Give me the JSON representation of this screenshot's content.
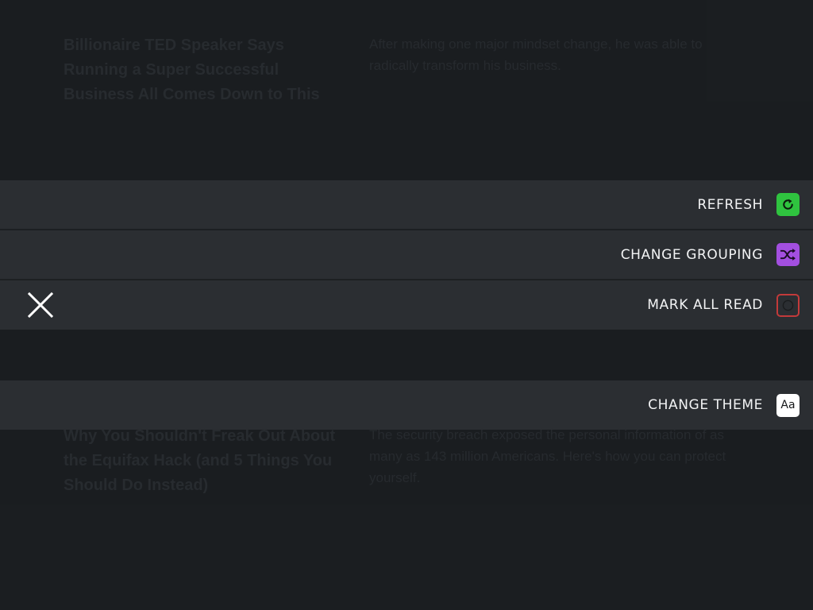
{
  "background_articles": [
    {
      "title": "Billionaire TED Speaker Says Running a Super Successful Business All Comes Down to This",
      "summary": "After making one major mindset change, he was able to radically transform his business."
    },
    {
      "title": "Why You Shouldn't Freak Out About the Equifax Hack (and 5 Things You Should Do Instead)",
      "summary": "The security breach exposed the personal information of as many as 143 million Americans. Here's how you can protect yourself."
    }
  ],
  "menu": {
    "items": [
      {
        "label": "REFRESH",
        "icon": "refresh-icon",
        "color": "#2fc33f"
      },
      {
        "label": "CHANGE GROUPING",
        "icon": "shuffle-icon",
        "color": "#a34fe0"
      },
      {
        "label": "MARK ALL READ",
        "icon": "circle-icon",
        "color": "#c23a3a"
      },
      {
        "label": "CHANGE THEME",
        "icon": "font-icon",
        "glyph": "Aa",
        "color": "#ffffff"
      }
    ],
    "close_icon": "close-icon"
  }
}
